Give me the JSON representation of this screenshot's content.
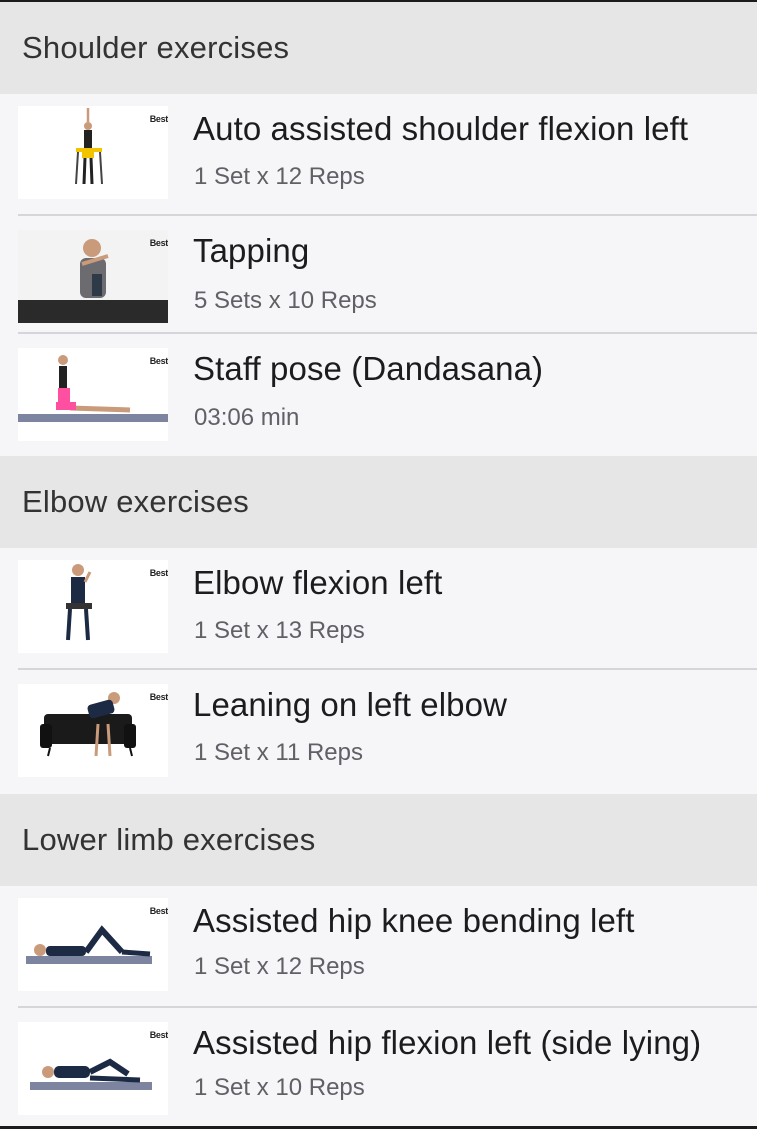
{
  "brand_logo": "Best",
  "sections": [
    {
      "title": "Shoulder exercises",
      "exercises": [
        {
          "name": "Auto assisted shoulder flexion left",
          "detail": "1 Set x 12 Reps",
          "thumbnail": "person-seated-arms-raised"
        },
        {
          "name": "Tapping",
          "detail": "5 Sets x 10 Reps",
          "thumbnail": "person-at-table-tapping"
        },
        {
          "name": "Staff pose (Dandasana)",
          "detail": "03:06 min",
          "thumbnail": "person-seated-on-mat"
        }
      ]
    },
    {
      "title": "Elbow exercises",
      "exercises": [
        {
          "name": "Elbow flexion left",
          "detail": "1 Set x 13 Reps",
          "thumbnail": "person-seated-elbow-bend"
        },
        {
          "name": "Leaning on left elbow",
          "detail": "1 Set x 11 Reps",
          "thumbnail": "person-leaning-on-sofa"
        }
      ]
    },
    {
      "title": "Lower limb exercises",
      "exercises": [
        {
          "name": "Assisted hip knee bending left",
          "detail": "1 Set x 12 Reps",
          "thumbnail": "person-lying-knee-bend"
        },
        {
          "name": "Assisted hip flexion left (side lying)",
          "detail": "1 Set x 10 Reps",
          "thumbnail": "person-side-lying"
        }
      ]
    }
  ],
  "colors": {
    "page_background": "#f6f6f8",
    "section_header_background": "#e6e6e6",
    "divider": "#d6d6da",
    "title_text": "#1c1c1e",
    "subtitle_text": "#606066",
    "thumbnail_accent_pink": "#ff4fa0",
    "thumbnail_mat": "#7d84a0"
  }
}
